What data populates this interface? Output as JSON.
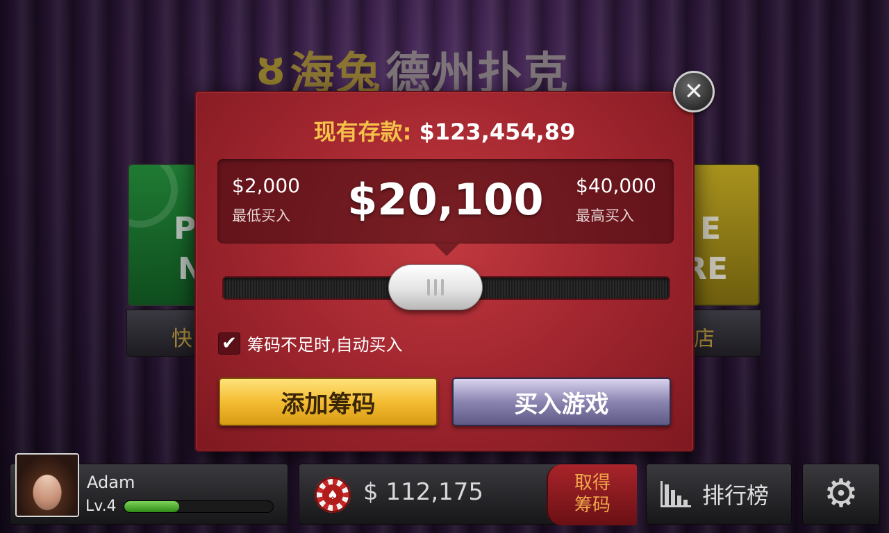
{
  "background": {
    "title_part1": "海兔",
    "title_part2": "德州扑克",
    "left_card_text_a": "P",
    "left_card_text_b": "N",
    "left_card_label": "快",
    "right_card_text_a": "E",
    "right_card_text_b": "RE",
    "right_card_label": "店"
  },
  "modal": {
    "balance_label": "现有存款:",
    "balance_value": "$123,454,89",
    "min_value": "$2,000",
    "min_label": "最低买入",
    "current_value": "$20,100",
    "max_value": "$40,000",
    "max_label": "最高买入",
    "slider_fraction": 0.47,
    "auto_buy_checked": true,
    "auto_buy_label": "筹码不足时,自动买入",
    "add_chips_label": "添加筹码",
    "join_game_label": "买入游戏",
    "close_icon": "✕"
  },
  "bottom_bar": {
    "player_name": "Adam",
    "player_level": "Lv.4",
    "xp_fraction": 0.37,
    "chips_value": "$ 112,175",
    "get_chips_line1": "取得",
    "get_chips_line2": "筹码",
    "leaderboard_label": "排行榜",
    "settings_icon": "⚙"
  },
  "colors": {
    "modal_red": "#a42730",
    "balance_gold": "#f5c14a",
    "add_button_gold": "#f4bd33",
    "join_button_purple": "#8a84b0",
    "xp_green": "#2f8a16"
  }
}
